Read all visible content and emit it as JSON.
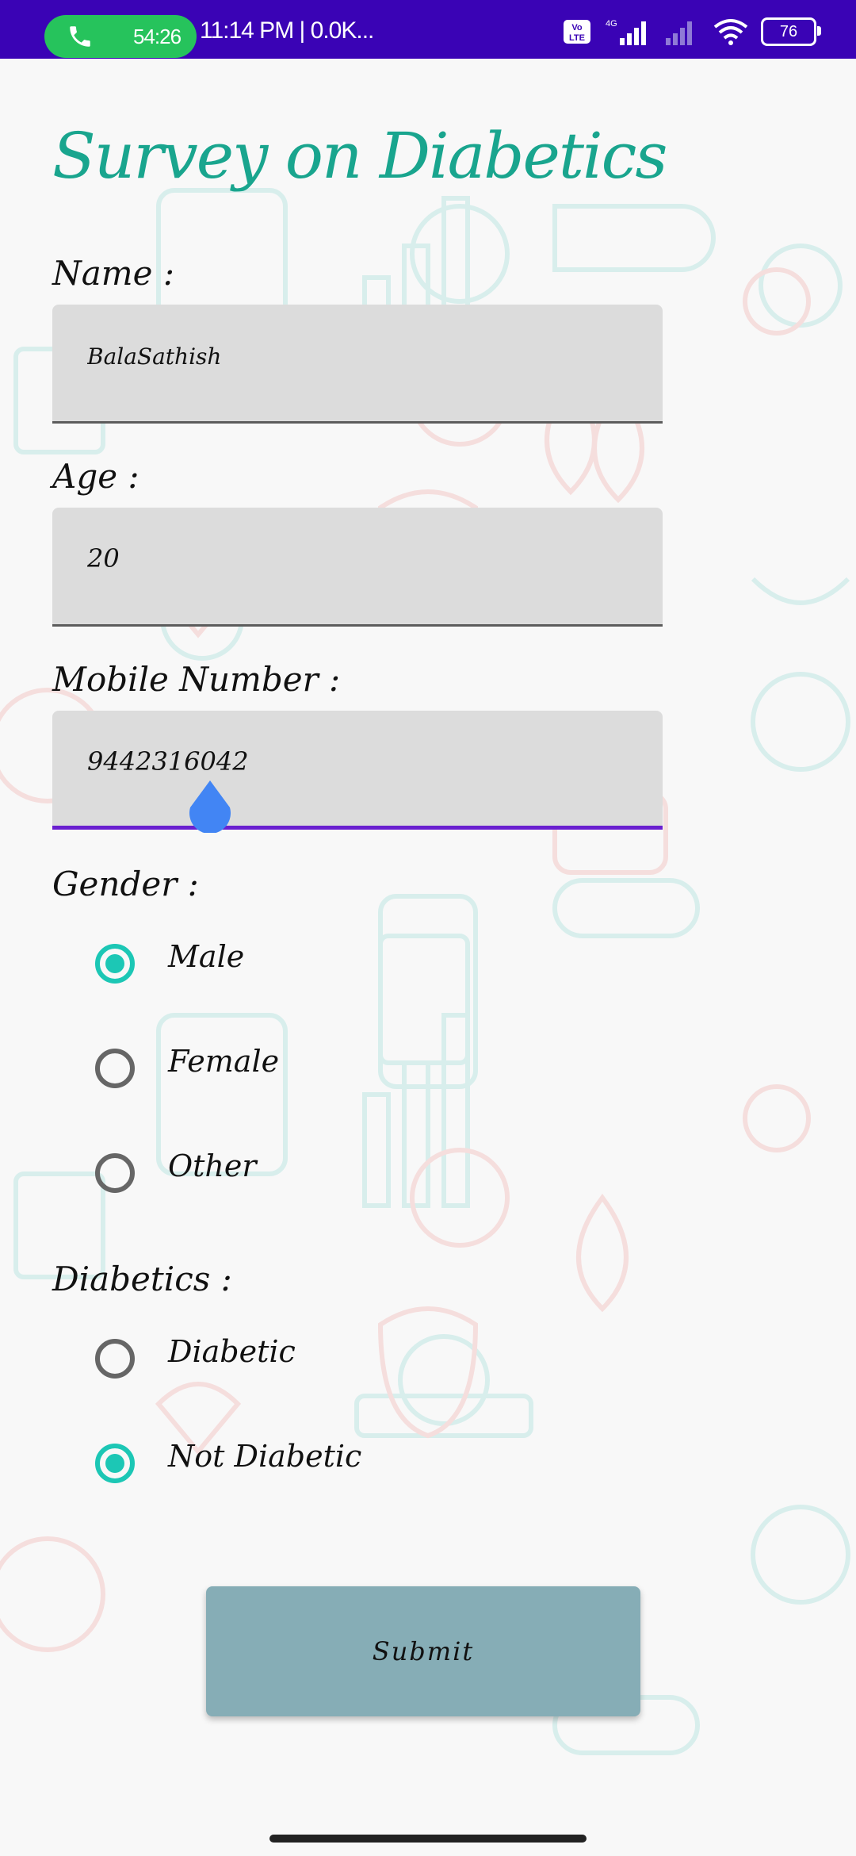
{
  "status_bar": {
    "call_timer": "54:26",
    "status_text": "11:14 PM | 0.0K...",
    "network_label": "4G",
    "volte_label": "Vo LTE",
    "battery": "76",
    "bar_color": "#3a03b5",
    "call_pill_color": "#26c35c"
  },
  "form": {
    "title": "Survey on Diabetics",
    "name_label": "Name :",
    "name_value": "BalaSathish",
    "age_label": "Age :",
    "age_value": "20",
    "mobile_label": "Mobile Number :",
    "mobile_value": "9442316042",
    "gender_label": "Gender :",
    "gender_options": [
      {
        "label": "Male",
        "checked": true
      },
      {
        "label": "Female",
        "checked": false
      },
      {
        "label": "Other",
        "checked": false
      }
    ],
    "diabetics_label": "Diabetics :",
    "diabetics_options": [
      {
        "label": "Diabetic",
        "checked": false
      },
      {
        "label": "Not Diabetic",
        "checked": true
      }
    ],
    "submit_label": "Submit"
  },
  "colors": {
    "title": "#19a58e",
    "radio_checked": "#1cc7b5",
    "active_underline": "#6a1fd0",
    "submit_bg": "#86adb6"
  }
}
